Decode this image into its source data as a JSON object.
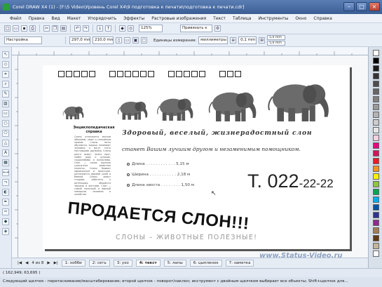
{
  "window": {
    "title": "Corel DRAW X4 (1) - [F:\\5 Video\\Уровень Corel X4\\9 подготовка к печати\\подготовка к печати.cdr]"
  },
  "menu": [
    "Файл",
    "Правка",
    "Вид",
    "Макет",
    "Упорядочить",
    "Эффекты",
    "Растровые изображения",
    "Текст",
    "Таблица",
    "Инструменты",
    "Окно",
    "Справка"
  ],
  "toolbar": {
    "zoom": "125%",
    "snap": "Привязать к",
    "preset": "Настройка",
    "width": "297,0 mm",
    "height": "210,0 mm",
    "units_label": "Единицы измерения:",
    "units": "миллиметры",
    "nudge": "0,1 mm",
    "dup_x": "5,0 mm",
    "dup_y": "5,0 mm"
  },
  "page": {
    "encyclopedia_title": "Энциклопедическая справка",
    "encyclopedia_text": "Слоны отличаются мягким обаянием, умом и спокойным нравом. Слоны легко обучаются, хорошо понимают человека и могут стать настоящими друзьями. Слоны долго живут, много едят, любят воду и купание, трудолюбивы и выносливы. Слон — самое крупное сухопутное животное планеты. Слоны бывают африканские и азиатские, различаются формой ушей и бивней. Слоны живут стадами, заботятся о детёнышах, общаются звуками и жестами. Слон — самый полезный и верный помощник человека в хозяйстве.",
    "headline": "Здоровый, веселый, жизнерадостный слон",
    "subline": "станет Вашим лучшим другом и незаменимым помощником.",
    "specs": [
      {
        "label": "Длина",
        "value": "5,15 м"
      },
      {
        "label": "Ширина",
        "value": "2,18 м"
      },
      {
        "label": "Длина хвоста",
        "value": "1,50 м"
      }
    ],
    "phone_prefix": "Т. 022",
    "phone_suffix": "-22-22",
    "sale": "ПРОДАЕТСЯ СЛОН!!!",
    "useful": "СЛОНЫ – ЖИВОТНЫЕ ПОЛЕЗНЫЕ!"
  },
  "tabs": {
    "page_counter": "4 из 8",
    "items": [
      "1: хобби",
      "2: сеть",
      "3: ухо",
      "4: текст",
      "5: лапы",
      "6: цыпленок",
      "7: заметка",
      "8: ..."
    ]
  },
  "status": {
    "coords": "( 162,949; 63,695 )",
    "hint": "Следующий щелчок - перетаскивание/масштабирование; второй щелчок - поворот/наклон; инструмент с двойным щелчком выбирает все объекты; Shift+щелчок для..."
  },
  "watermark": "www.Status-Video.ru",
  "colors": {
    "palette": [
      "#ffffff",
      "#000000",
      "#1a1a1a",
      "#333333",
      "#4d4d4d",
      "#666666",
      "#808080",
      "#999999",
      "#b3b3b3",
      "#cccccc",
      "#e6e6e6",
      "#f5d0e0",
      "#e9007f",
      "#d4145a",
      "#ed1c24",
      "#f7941d",
      "#fff200",
      "#8dc63f",
      "#00a651",
      "#00aeef",
      "#0054a6",
      "#2e3192",
      "#92278f",
      "#a67c52",
      "#603913",
      "#c2b59b",
      "#ffffff"
    ]
  }
}
